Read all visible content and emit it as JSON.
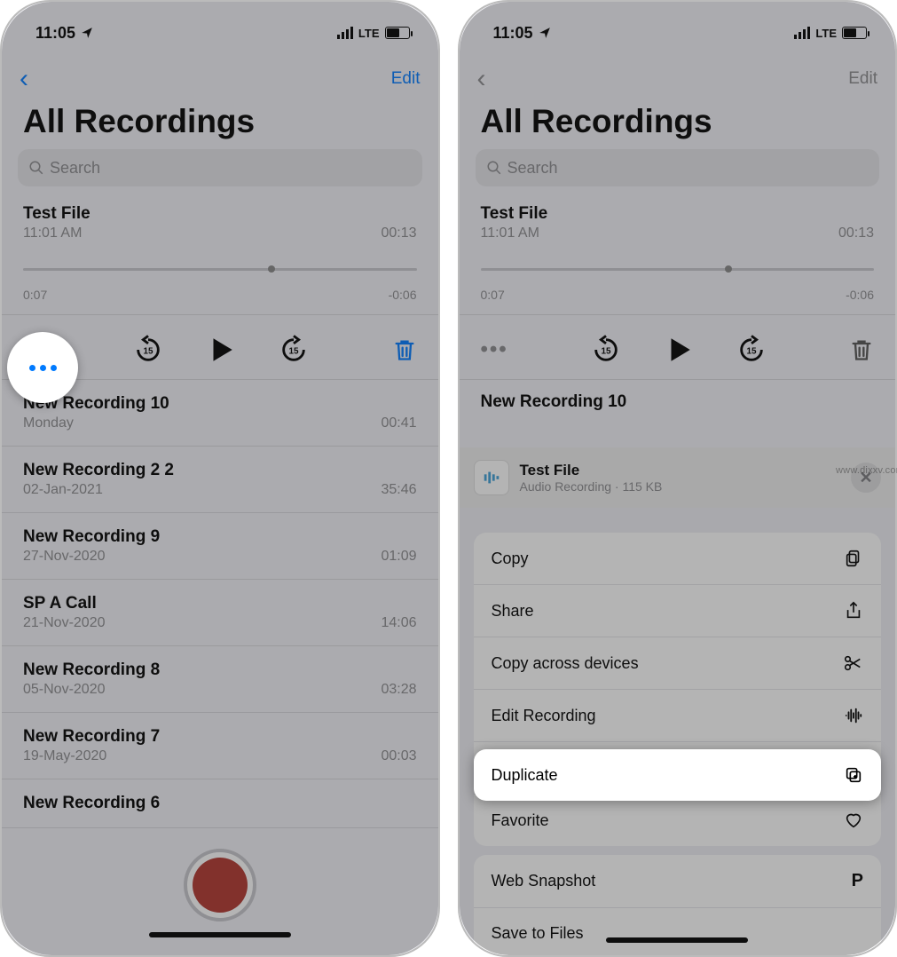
{
  "status": {
    "time": "11:05",
    "net": "LTE"
  },
  "nav": {
    "edit": "Edit"
  },
  "title": "All Recordings",
  "search": {
    "placeholder": "Search"
  },
  "expanded": {
    "title": "Test File",
    "time": "11:01 AM",
    "dur": "00:13",
    "posLeft": "0:07",
    "posRight": "-0:06"
  },
  "leftList": [
    {
      "title": "New Recording 10",
      "sub": "Monday",
      "dur": "00:41"
    },
    {
      "title": "New Recording 2 2",
      "sub": "02-Jan-2021",
      "dur": "35:46"
    },
    {
      "title": "New Recording 9",
      "sub": "27-Nov-2020",
      "dur": "01:09"
    },
    {
      "title": "SP A Call",
      "sub": "21-Nov-2020",
      "dur": "14:06"
    },
    {
      "title": "New Recording 8",
      "sub": "05-Nov-2020",
      "dur": "03:28"
    },
    {
      "title": "New Recording 7",
      "sub": "19-May-2020",
      "dur": "00:03"
    },
    {
      "title": "New Recording 6",
      "sub": "",
      "dur": ""
    }
  ],
  "rightPeek": "New Recording 10",
  "sheet": {
    "title": "Test File",
    "sub": "Audio Recording · 115 KB"
  },
  "menu": {
    "copy": "Copy",
    "share": "Share",
    "copyAcross": "Copy across devices",
    "editRec": "Edit Recording",
    "duplicate": "Duplicate",
    "favorite": "Favorite",
    "webSnap": "Web Snapshot",
    "saveFiles": "Save to Files"
  },
  "watermark": "www.dixxv.com"
}
